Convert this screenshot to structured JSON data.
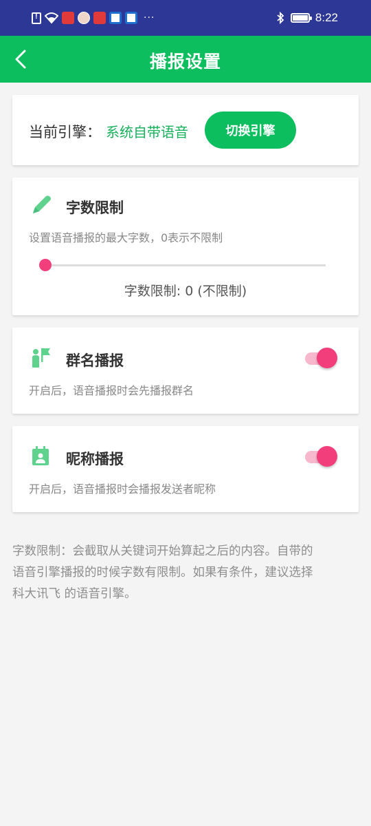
{
  "status_bar": {
    "time": "8:22",
    "overflow": "···",
    "icons": [
      "sim-alert-icon",
      "wifi-icon",
      "app-notification-icon",
      "avatar-notification-icon",
      "app-notification-icon",
      "app-notification-icon",
      "app-notification-icon",
      "bluetooth-icon",
      "battery-icon"
    ]
  },
  "header": {
    "title": "播报设置",
    "back_icon": "chevron-left-icon"
  },
  "engine": {
    "label": "当前引擎：",
    "name": "系统自带语音",
    "switch_label": "切换引擎"
  },
  "char_limit": {
    "icon": "pencil-icon",
    "title": "字数限制",
    "description": "设置语音播报的最大字数，0表示不限制",
    "slider_value": 0,
    "value_text": "字数限制: 0 (不限制)"
  },
  "group_name": {
    "icon": "group-flag-icon",
    "title": "群名播报",
    "description": "开启后，语音播报时会先播报群名",
    "enabled": true
  },
  "nickname": {
    "icon": "calendar-person-icon",
    "title": "昵称播报",
    "description": "开启后，语音播报时会播报发送者昵称",
    "enabled": true
  },
  "note": {
    "line1": "字数限制：会截取从关键词开始算起之后的内容。自带的",
    "line2": "语音引擎播报的时候字数有限制。如果有条件，建议选择",
    "line3": "科大讯飞 的语音引擎。"
  },
  "colors": {
    "status_bar": "#2d3796",
    "app_bar": "#0cbe5e",
    "accent_green": "#18b15d",
    "toggle_pink": "#f23e7a",
    "icon_green": "#5fd38e"
  }
}
